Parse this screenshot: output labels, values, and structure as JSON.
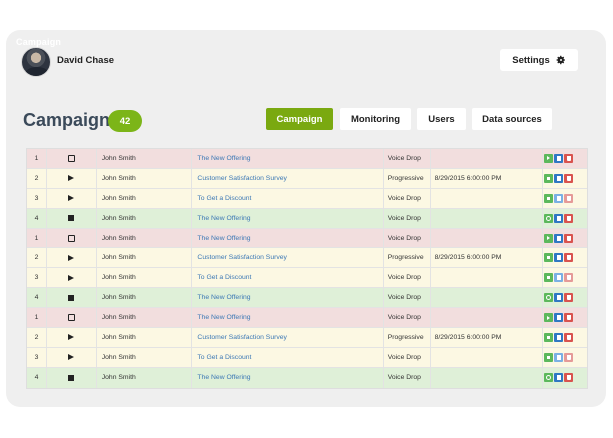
{
  "header": {
    "section_label": "Campaign",
    "user_name": "David Chase",
    "settings_label": "Settings"
  },
  "page": {
    "title": "Campaigns",
    "count": "42"
  },
  "tabs": [
    {
      "label": "Campaign",
      "active": true
    },
    {
      "label": "Monitoring",
      "active": false
    },
    {
      "label": "Users",
      "active": false
    },
    {
      "label": "Data sources",
      "active": false
    }
  ],
  "colors": {
    "accent": "#7aa910",
    "row_red": "#f2dede",
    "row_yellow": "#fcf8e3",
    "row_green": "#dff0d8"
  },
  "table": {
    "rows": [
      {
        "num": "1",
        "status": "edit-icon",
        "name": "John Smith",
        "campaign": "The New Offering",
        "type": "Voice Drop",
        "date": "",
        "color": "red",
        "actions": [
          "play",
          "doc",
          "trash"
        ]
      },
      {
        "num": "2",
        "status": "play-icon",
        "name": "John Smith",
        "campaign": "Customer Satisfaction Survey",
        "type": "Progressive",
        "date": "8/29/2015 6:00:00 PM",
        "color": "yellow",
        "actions": [
          "stop",
          "doc",
          "trash"
        ]
      },
      {
        "num": "3",
        "status": "play-icon",
        "name": "John Smith",
        "campaign": "To Get a Discount",
        "type": "Voice Drop",
        "date": "",
        "color": "yellow",
        "actions": [
          "stop",
          "doc-light",
          "trash-light"
        ]
      },
      {
        "num": "4",
        "status": "stop-icon",
        "name": "John Smith",
        "campaign": "The New Offering",
        "type": "Voice Drop",
        "date": "",
        "color": "green",
        "actions": [
          "clock",
          "doc",
          "trash"
        ]
      },
      {
        "num": "1",
        "status": "edit-icon",
        "name": "John Smith",
        "campaign": "The New Offering",
        "type": "Voice Drop",
        "date": "",
        "color": "red",
        "actions": [
          "play",
          "doc",
          "trash"
        ]
      },
      {
        "num": "2",
        "status": "play-icon",
        "name": "John Smith",
        "campaign": "Customer Satisfaction Survey",
        "type": "Progressive",
        "date": "8/29/2015 6:00:00 PM",
        "color": "yellow",
        "actions": [
          "stop",
          "doc",
          "trash"
        ]
      },
      {
        "num": "3",
        "status": "play-icon",
        "name": "John Smith",
        "campaign": "To Get a Discount",
        "type": "Voice Drop",
        "date": "",
        "color": "yellow",
        "actions": [
          "stop",
          "doc-light",
          "trash-light"
        ]
      },
      {
        "num": "4",
        "status": "stop-icon",
        "name": "John Smith",
        "campaign": "The New Offering",
        "type": "Voice Drop",
        "date": "",
        "color": "green",
        "actions": [
          "clock",
          "doc",
          "trash"
        ]
      },
      {
        "num": "1",
        "status": "edit-icon",
        "name": "John Smith",
        "campaign": "The New Offering",
        "type": "Voice Drop",
        "date": "",
        "color": "red",
        "actions": [
          "play",
          "doc",
          "trash"
        ]
      },
      {
        "num": "2",
        "status": "play-icon",
        "name": "John Smith",
        "campaign": "Customer Satisfaction Survey",
        "type": "Progressive",
        "date": "8/29/2015 6:00:00 PM",
        "color": "yellow",
        "actions": [
          "stop",
          "doc",
          "trash"
        ]
      },
      {
        "num": "3",
        "status": "play-icon",
        "name": "John Smith",
        "campaign": "To Get a Discount",
        "type": "Voice Drop",
        "date": "",
        "color": "yellow",
        "actions": [
          "stop",
          "doc-light",
          "trash-light"
        ]
      },
      {
        "num": "4",
        "status": "stop-icon",
        "name": "John Smith",
        "campaign": "The New Offering",
        "type": "Voice Drop",
        "date": "",
        "color": "green",
        "actions": [
          "clock",
          "doc",
          "trash"
        ]
      }
    ]
  }
}
